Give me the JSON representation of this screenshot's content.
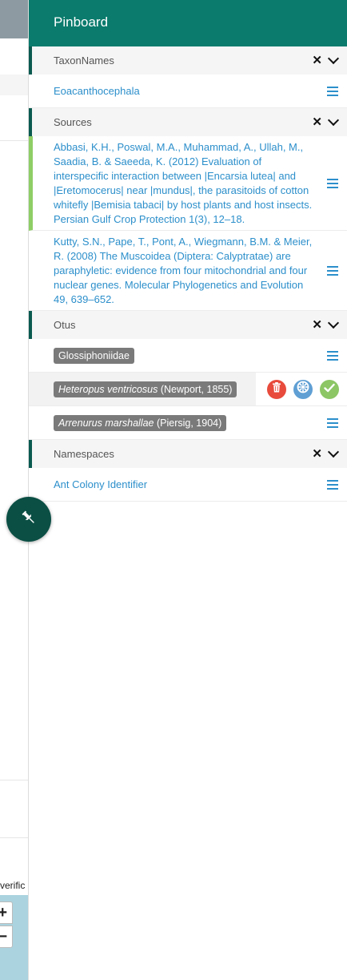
{
  "left_app": {
    "partial_text": "verific"
  },
  "pinboard": {
    "title": "Pinboard",
    "sections": {
      "taxon_names": {
        "label": "TaxonNames",
        "items": [
          "Eoacanthocephala"
        ]
      },
      "sources": {
        "label": "Sources",
        "items": [
          "Abbasi, K.H., Poswal, M.A., Muhammad, A., Ullah, M., Saadia, B. & Saeeda, K. (2012) Evaluation of interspecific interaction between |Encarsia lutea| and |Eretomocerus| near |mundus|, the parasitoids of cotton whitefly |Bemisia tabaci| by host plants and host insects. Persian Gulf Crop Protection 1(3), 12–18.",
          "Kutty, S.N., Pape, T., Pont, A., Wiegmann, B.M. & Meier, R. (2008) The Muscoidea (Diptera: Calyptratae) are paraphyletic: evidence from four mitochondrial and four nuclear genes. Molecular Phylogenetics and Evolution 49, 639–652."
        ]
      },
      "otus": {
        "label": "Otus",
        "items": [
          {
            "name": "Glossiphoniidae",
            "author": ""
          },
          {
            "name": "Heteropus ventricosus",
            "author": " (Newport, 1855)"
          },
          {
            "name": "Arrenurus marshallae",
            "author": " (Piersig, 1904)"
          }
        ]
      },
      "namespaces": {
        "label": "Namespaces",
        "items": [
          "Ant Colony Identifier"
        ]
      }
    }
  },
  "colors": {
    "header_green": "#0a7b6d",
    "link_blue": "#2c8fcb",
    "active_green": "#8fce66",
    "delete_red": "#e84b3c",
    "radial_blue": "#5f9fd4",
    "ok_green": "#8cc665"
  },
  "icons": {
    "section_close": "x-icon",
    "section_collapse": "chevron-down-icon",
    "item_menu": "hamburger-icon",
    "delete": "trash-icon",
    "radial": "radial-menu-icon",
    "default": "check-icon",
    "pin": "pin-icon"
  }
}
